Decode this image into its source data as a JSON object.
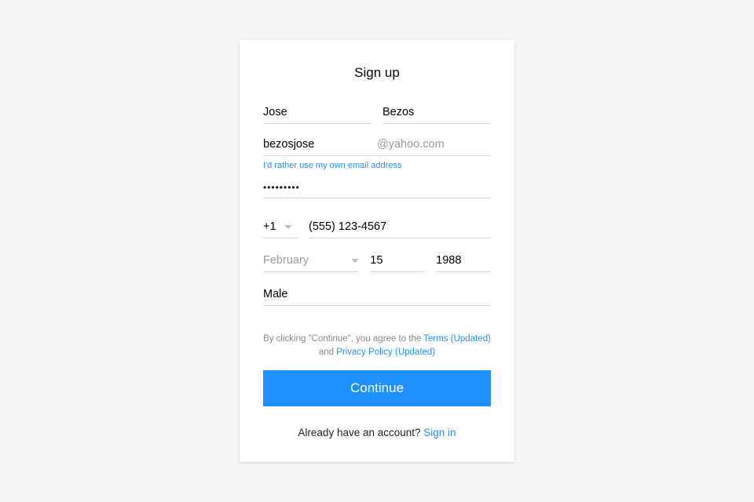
{
  "title": "Sign up",
  "name": {
    "first": "Jose",
    "last": "Bezos"
  },
  "email": {
    "local": "bezosjose",
    "domain_suffix": "@yahoo.com"
  },
  "own_email_link": "I'd rather use my own email address",
  "password_mask": "•••••••••",
  "phone": {
    "country_code": "+1",
    "number": "(555) 123-4567"
  },
  "dob": {
    "month": "February",
    "day": "15",
    "year": "1988"
  },
  "gender": {
    "value": "Male"
  },
  "terms": {
    "prefix": "By clicking \"Continue\", you agree to the ",
    "terms_link": "Terms (Updated)",
    "middle": " and ",
    "privacy_link": "Privacy Policy (Updated)"
  },
  "continue_label": "Continue",
  "signin": {
    "prompt": "Already have an account? ",
    "link": "Sign in"
  }
}
